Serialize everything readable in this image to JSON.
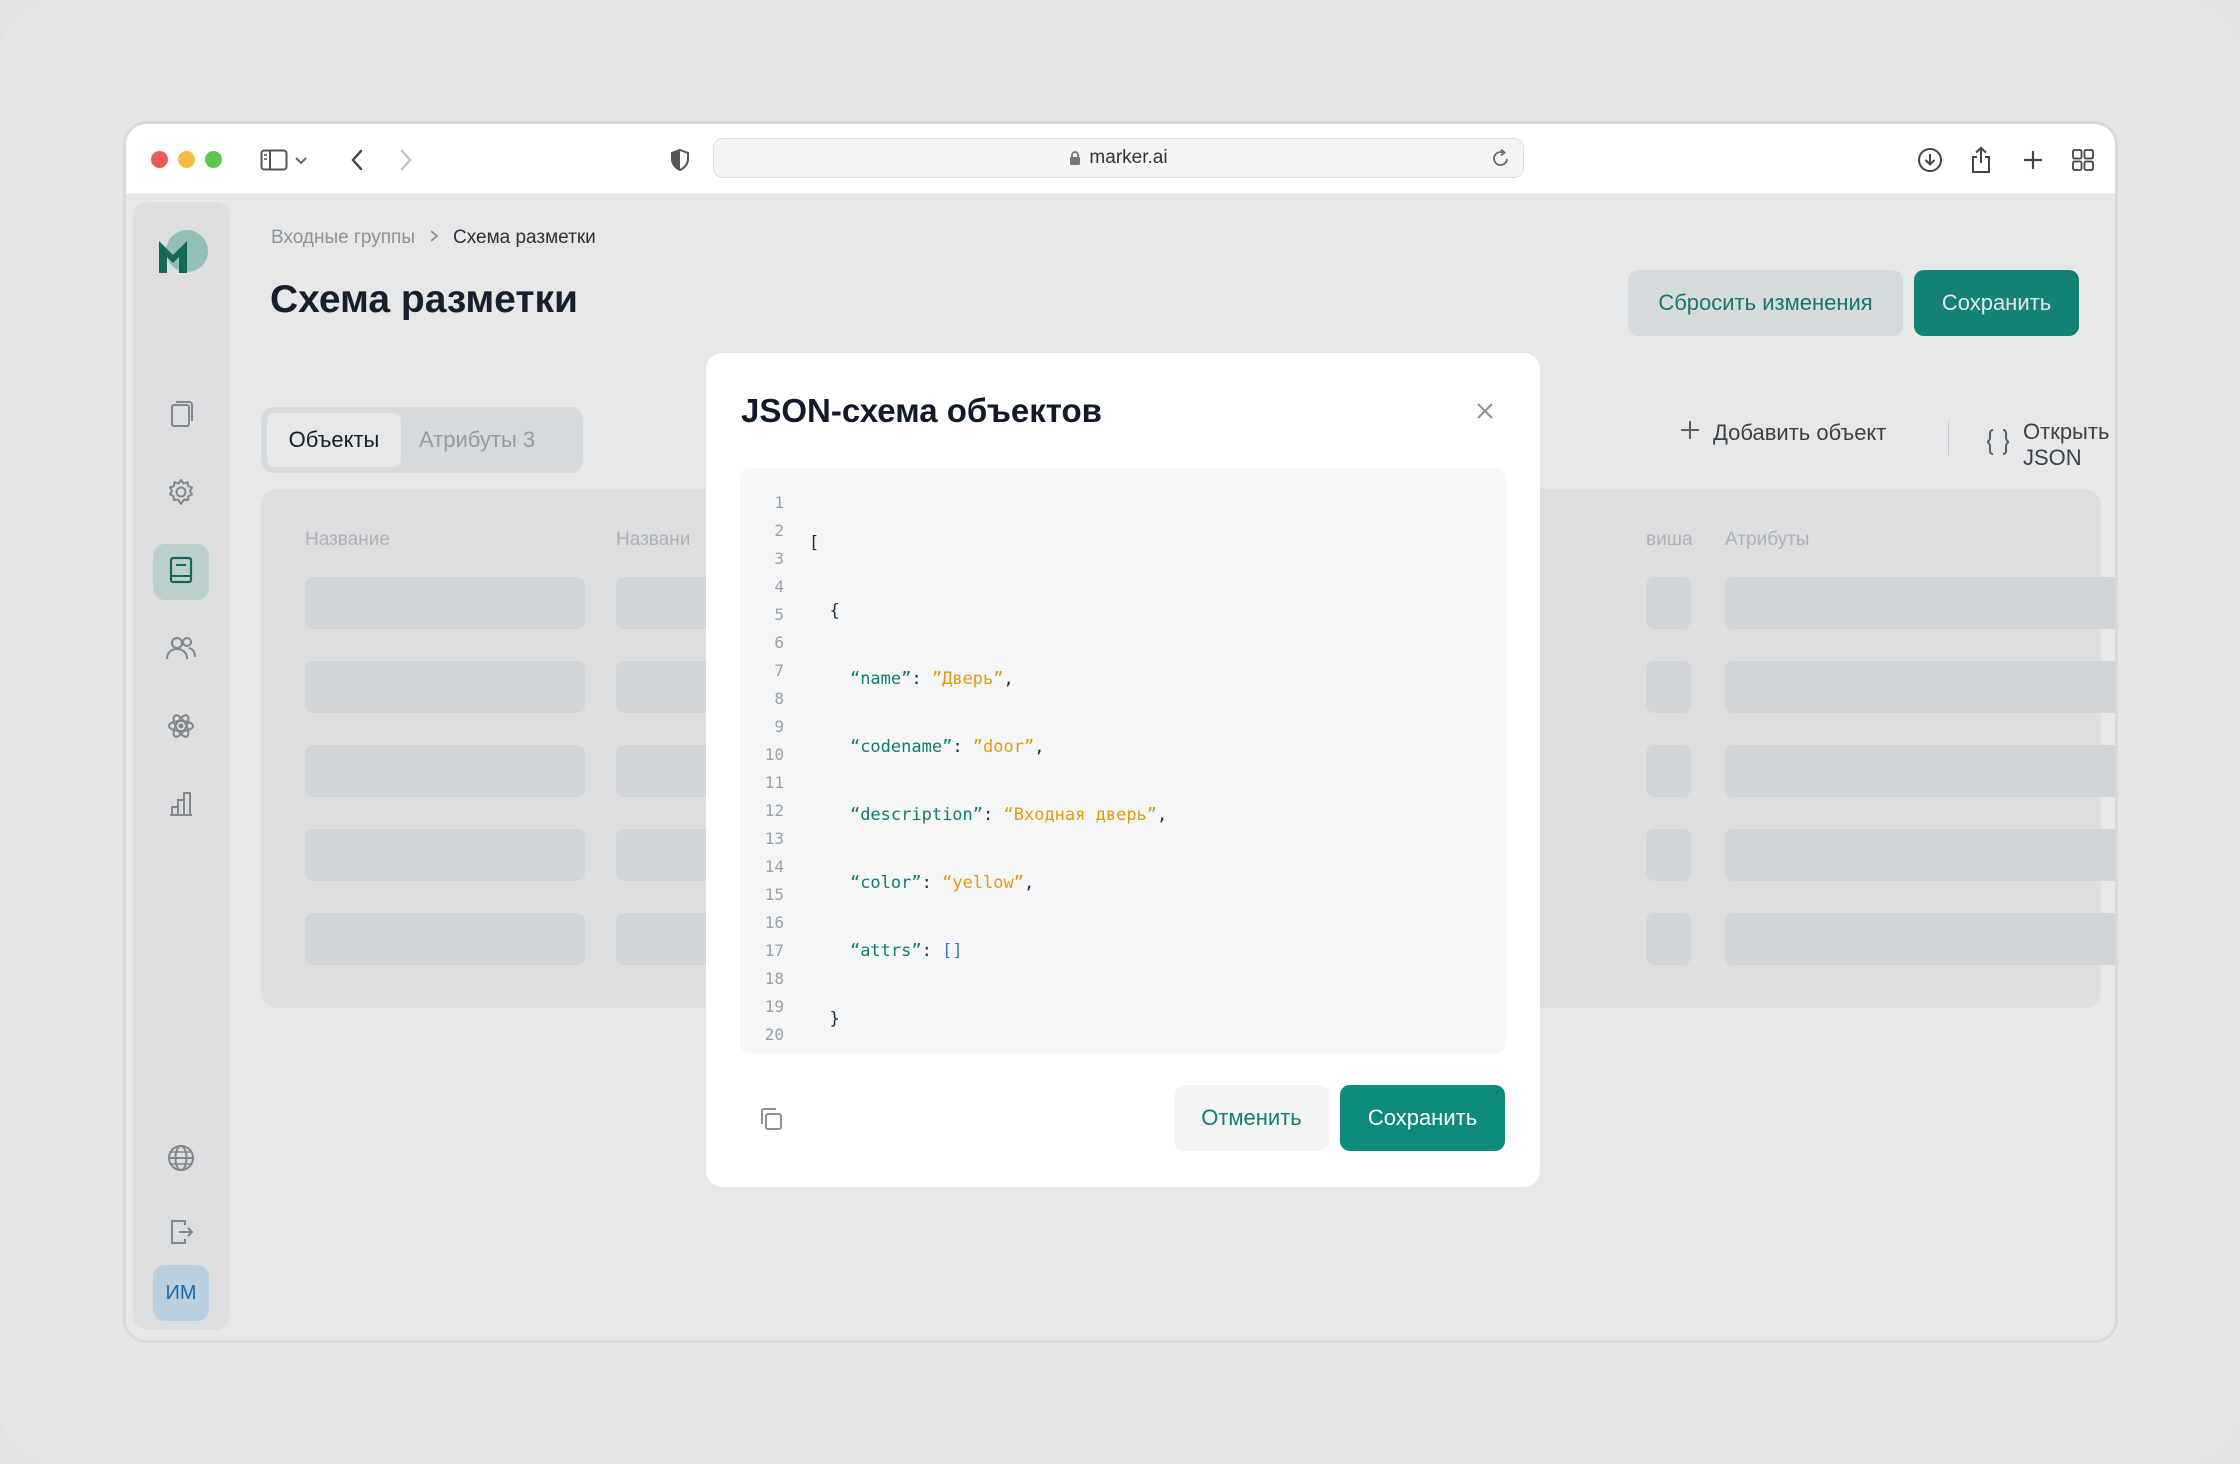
{
  "browser": {
    "url": "marker.ai",
    "icons": [
      "sidebar-toggle-icon",
      "chevron-down-icon",
      "back-icon",
      "forward-icon",
      "shield-icon",
      "lock-icon",
      "reload-icon",
      "download-icon",
      "share-icon",
      "plus-icon",
      "tabs-grid-icon"
    ]
  },
  "sidebar": {
    "items": [
      "documents-icon",
      "settings-icon",
      "book-icon",
      "users-icon",
      "atom-icon",
      "chart-icon"
    ],
    "active_index": 2,
    "bottom": [
      "globe-icon",
      "logout-icon"
    ],
    "avatar": "ИМ"
  },
  "header": {
    "breadcrumb": [
      "Входные группы",
      "Схема разметки"
    ],
    "title": "Схема разметки",
    "reset_label": "Сбросить изменения",
    "save_label": "Сохранить"
  },
  "tabs": [
    {
      "label": "Объекты",
      "active": true
    },
    {
      "label": "Атрибуты 3",
      "active": false
    }
  ],
  "actions": {
    "add_object": "Добавить объект",
    "open_json": "Открыть JSON"
  },
  "table": {
    "columns": [
      "Название",
      "Названи",
      "виша",
      "Атрибуты"
    ]
  },
  "modal": {
    "title": "JSON-схема объектов",
    "cancel_label": "Отменить",
    "save_label": "Сохранить",
    "line_numbers": [
      "1",
      "2",
      "3",
      "4",
      "5",
      "6",
      "7",
      "8",
      "9",
      "10",
      "11",
      "12",
      "13",
      "14",
      "15",
      "16",
      "17",
      "18",
      "19",
      "20"
    ],
    "code": {
      "open_bracket": "[",
      "open_brace": "{",
      "name_key": "“name”",
      "name_val": "”Дверь”",
      "codename_key": "“codename”",
      "codename_val": "”door”",
      "description_key": "“description”",
      "description_val": "“Входная дверь”",
      "color_key": "“color”",
      "color_val": "“yellow”",
      "attrs_key": "“attrs”",
      "attrs_val": "[]",
      "close_brace": "}",
      "close_bracket": "]"
    }
  },
  "colors": {
    "accent": "#0e8a7d",
    "accent_text": "#0e7f74",
    "json_key": "#127b70",
    "json_string": "#e39a10",
    "json_array": "#3079c8"
  }
}
